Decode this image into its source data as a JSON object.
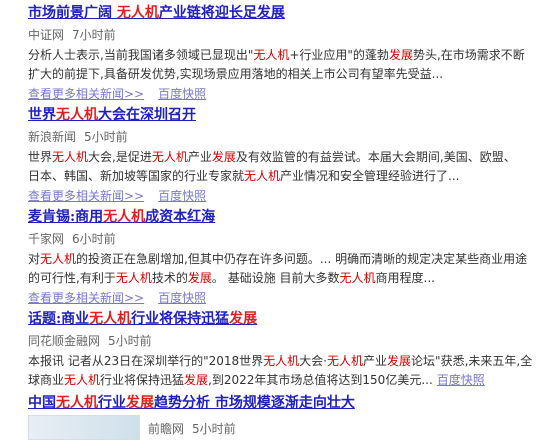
{
  "results": [
    {
      "title": [
        {
          "t": "市场前景广阔 ",
          "h": false
        },
        {
          "t": "无人机",
          "h": true
        },
        {
          "t": "产业链将迎长足发展",
          "h": false
        }
      ],
      "source": "中证网",
      "time": "7小时前",
      "desc_lines": [
        [
          {
            "t": "分析人士表示,当前我国诸多领域已显现出\"",
            "h": false
          },
          {
            "t": "无人机",
            "h": true
          },
          {
            "t": "+行业应用\"的蓬勃",
            "h": false
          },
          {
            "t": "发展",
            "h": true
          },
          {
            "t": "势头,在市场需求不断",
            "h": false
          }
        ],
        [
          {
            "t": "扩大的前提下,具备研发优势,实现场景应用落地的相关上市公司有望率先受益...",
            "h": false
          }
        ]
      ],
      "more_label": "查看更多相关新闻>>",
      "snapshot_label": "百度快照"
    },
    {
      "title": [
        {
          "t": "世界",
          "h": false
        },
        {
          "t": "无人机",
          "h": true
        },
        {
          "t": "大会在深圳召开",
          "h": false
        }
      ],
      "source": "新浪新闻",
      "time": "5小时前",
      "desc_lines": [
        [
          {
            "t": "世界",
            "h": false
          },
          {
            "t": "无人机",
            "h": true
          },
          {
            "t": "大会,是促进",
            "h": false
          },
          {
            "t": "无人机",
            "h": true
          },
          {
            "t": "产业",
            "h": false
          },
          {
            "t": "发展",
            "h": true
          },
          {
            "t": "及有效监管的有益尝试。本届大会期间,美国、欧盟、",
            "h": false
          }
        ],
        [
          {
            "t": "日本、韩国、新加坡等国家的行业专家就",
            "h": false
          },
          {
            "t": "无人机",
            "h": true
          },
          {
            "t": "产业情况和安全管理经验进行了...",
            "h": false
          }
        ]
      ],
      "more_label": "查看更多相关新闻>>",
      "snapshot_label": "百度快照"
    },
    {
      "title": [
        {
          "t": "麦肯锡:商用",
          "h": false
        },
        {
          "t": "无人机",
          "h": true
        },
        {
          "t": "成资本红海",
          "h": false
        }
      ],
      "source": "千家网",
      "time": "6小时前",
      "desc_lines": [
        [
          {
            "t": "对",
            "h": false
          },
          {
            "t": "无人机",
            "h": true
          },
          {
            "t": "的投资正在急剧增加,但其中仍存在许多问题。... 明确而清晰的规定决定某些商业用途",
            "h": false
          }
        ],
        [
          {
            "t": "的可行性,有利于",
            "h": false
          },
          {
            "t": "无人机",
            "h": true
          },
          {
            "t": "技术的",
            "h": false
          },
          {
            "t": "发展",
            "h": true
          },
          {
            "t": "。 基础设施 目前大多数",
            "h": false
          },
          {
            "t": "无人机",
            "h": true
          },
          {
            "t": "商用程度...",
            "h": false
          }
        ]
      ],
      "more_label": "查看更多相关新闻>>",
      "snapshot_label": "百度快照"
    },
    {
      "title": [
        {
          "t": "话题:商业",
          "h": false
        },
        {
          "t": "无人机",
          "h": true
        },
        {
          "t": "行业将保持迅猛",
          "h": false
        },
        {
          "t": "发展",
          "h": true
        }
      ],
      "source": "同花顺金融网",
      "time": "5小时前",
      "desc_lines": [
        [
          {
            "t": "本报讯 记者从23日在深圳举行的\"2018世界",
            "h": false
          },
          {
            "t": "无人机",
            "h": true
          },
          {
            "t": "大会·",
            "h": false
          },
          {
            "t": "无人机",
            "h": true
          },
          {
            "t": "产业",
            "h": false
          },
          {
            "t": "发展",
            "h": true
          },
          {
            "t": "论坛\"获悉,未来五年,全",
            "h": false
          }
        ],
        [
          {
            "t": "球商业",
            "h": false
          },
          {
            "t": "无人机",
            "h": true
          },
          {
            "t": "行业将保持迅猛",
            "h": false
          },
          {
            "t": "发展",
            "h": true
          },
          {
            "t": ",到2022年其市场总值将达到150亿美元...",
            "h": false
          }
        ]
      ],
      "inline_snapshot_label": "百度快照"
    },
    {
      "title": [
        {
          "t": "中国",
          "h": false
        },
        {
          "t": "无人机",
          "h": true
        },
        {
          "t": "行业",
          "h": false
        },
        {
          "t": "发展",
          "h": true
        },
        {
          "t": "趋势分析 市场规模逐渐走向壮大",
          "h": false
        }
      ],
      "source": "前瞻网",
      "time": "5小时前"
    }
  ]
}
